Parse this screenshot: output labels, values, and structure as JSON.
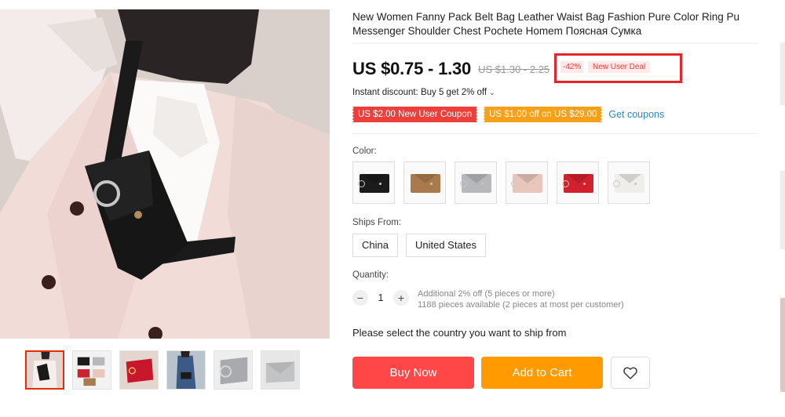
{
  "product": {
    "title": "New Women Fanny Pack Belt Bag Leather Waist Bag Fashion Pure Color Ring Pu Messenger Shoulder Chest Pochete Homem Поясная Сумка"
  },
  "price": {
    "current": "US $0.75 - 1.30",
    "original": "US $1.30 - 2.25",
    "discount": "-42%",
    "deal_label": "New User Deal"
  },
  "promo": {
    "instant_discount": "Instant discount: Buy 5 get 2% off",
    "coupons": [
      "US $2.00 New User Coupon",
      "US $1.00 off on US $29.00"
    ],
    "get_coupons": "Get coupons"
  },
  "color": {
    "label": "Color:",
    "swatches": [
      {
        "icon": "black-bag-swatch",
        "color": "#1b1b1b"
      },
      {
        "icon": "brown-bag-swatch",
        "color": "#a97a4e"
      },
      {
        "icon": "gray-bag-swatch",
        "color": "#b7b8bc"
      },
      {
        "icon": "pink-bag-swatch",
        "color": "#e9c6bb"
      },
      {
        "icon": "red-bag-swatch",
        "color": "#d1202e"
      },
      {
        "icon": "white-bag-swatch",
        "color": "#efeeea"
      }
    ]
  },
  "shipping": {
    "label": "Ships From:",
    "options": [
      "China",
      "United States"
    ],
    "note": "Please select the country you want to ship from"
  },
  "quantity": {
    "label": "Quantity:",
    "value": "1",
    "minus": "−",
    "plus": "+",
    "info_line1": "Additional 2% off (5 pieces or more)",
    "info_line2": "1188 pieces available (2 pieces at most per customer)"
  },
  "actions": {
    "buy_now": "Buy Now",
    "add_to_cart": "Add to Cart"
  },
  "icons": {
    "wishlist": "heart-icon",
    "instant_discount_toggle": "chevron-down-icon"
  },
  "colors": {
    "accent_red": "#ff4747",
    "accent_orange": "#ff9a01",
    "link_blue": "#2e86c1",
    "highlight_box": "#e5252a"
  }
}
